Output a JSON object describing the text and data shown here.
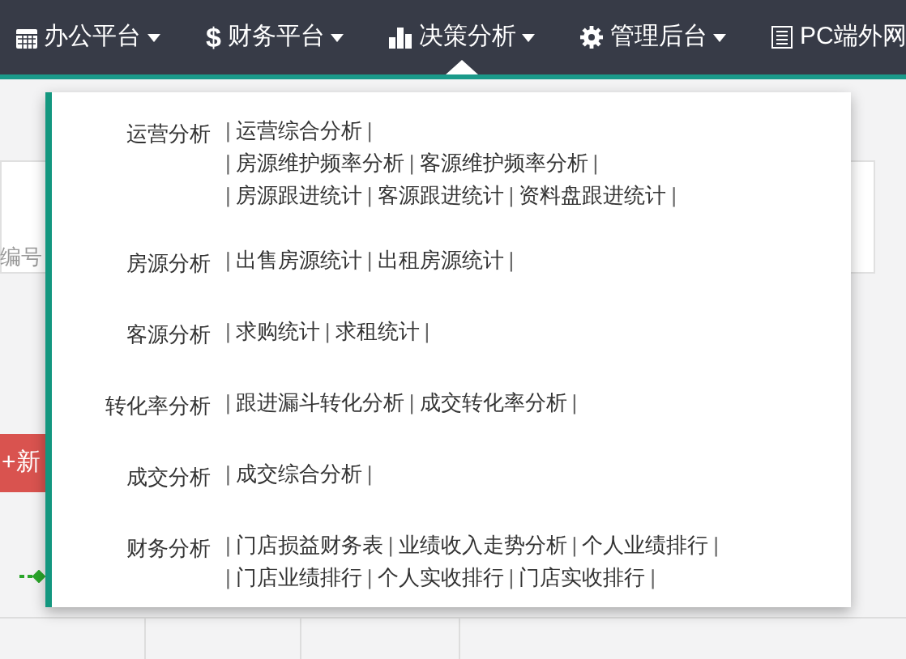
{
  "nav": [
    {
      "label": "办公平台",
      "caret": true,
      "selected": false
    },
    {
      "symbol": "$",
      "label": "财务平台",
      "caret": true,
      "selected": false
    },
    {
      "label": "决策分析",
      "caret": true,
      "selected": true
    },
    {
      "label": "管理后台",
      "caret": true,
      "selected": false
    },
    {
      "label": "PC端外网",
      "caret": false,
      "selected": false
    }
  ],
  "background": {
    "field_placeholder": "编号",
    "button": "+新"
  },
  "dropdown": {
    "separator": "|",
    "groups": [
      {
        "title": "运营分析",
        "lines": [
          [
            "运营综合分析"
          ],
          [
            "房源维护频率分析",
            "客源维护频率分析"
          ],
          [
            "房源跟进统计",
            "客源跟进统计",
            "资料盘跟进统计"
          ]
        ]
      },
      {
        "title": "房源分析",
        "lines": [
          [
            "出售房源统计",
            "出租房源统计"
          ]
        ]
      },
      {
        "title": "客源分析",
        "lines": [
          [
            "求购统计",
            "求租统计"
          ]
        ]
      },
      {
        "title": "转化率分析",
        "lines": [
          [
            "跟进漏斗转化分析",
            "成交转化率分析"
          ]
        ]
      },
      {
        "title": "成交分析",
        "lines": [
          [
            "成交综合分析"
          ]
        ]
      },
      {
        "title": "财务分析",
        "lines": [
          [
            "门店损益财务表",
            "业绩收入走势分析",
            "个人业绩排行"
          ],
          [
            "门店业绩排行",
            "个人实收排行",
            "门店实收排行"
          ]
        ]
      }
    ]
  }
}
